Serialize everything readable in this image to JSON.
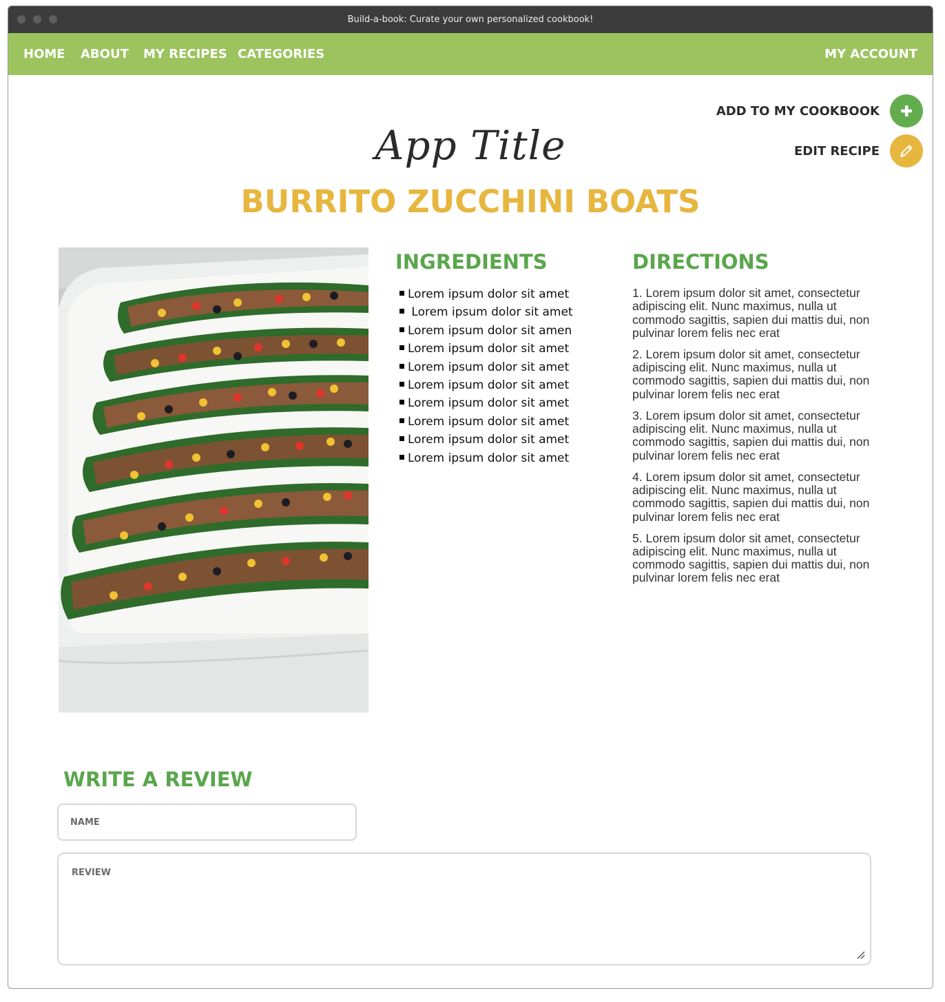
{
  "window": {
    "title": "Build-a-book: Curate your own personalized cookbook!"
  },
  "nav": {
    "home": "HOME",
    "about": "ABOUT",
    "my_recipes": "MY RECIPES",
    "categories": "CATEGORIES",
    "my_account": "MY ACCOUNT",
    "background_color": "#9cc35e"
  },
  "actions": {
    "add_label": "ADD TO MY COOKBOOK",
    "add_icon": "plus-icon",
    "add_color": "#63ad4f",
    "edit_label": "EDIT RECIPE",
    "edit_icon": "pencil-icon",
    "edit_color": "#e7b63f"
  },
  "app_title": "App Title",
  "recipe": {
    "title": "BURRITO ZUCCHINI BOATS",
    "title_color": "#e7b63f",
    "photo_alt": "burrito-zucchini-boats-photo",
    "ingredients_heading": "INGREDIENTS",
    "ingredients": [
      "Lorem ipsum dolor sit amet",
      " Lorem ipsum dolor sit amet",
      "Lorem ipsum dolor sit amen",
      "Lorem ipsum dolor sit amet",
      "Lorem ipsum dolor sit amet",
      "Lorem ipsum dolor sit amet",
      "Lorem ipsum dolor sit amet",
      "Lorem ipsum dolor sit amet",
      "Lorem ipsum dolor sit amet",
      "Lorem ipsum dolor sit amet"
    ],
    "directions_heading": "DIRECTIONS",
    "directions": [
      "1. Lorem ipsum dolor sit amet, consectetur adipiscing elit. Nunc maximus, nulla ut commodo sagittis, sapien dui mattis dui, non pulvinar lorem felis nec erat",
      "2. Lorem ipsum dolor sit amet, consectetur adipiscing elit. Nunc maximus, nulla ut commodo sagittis, sapien dui mattis dui, non pulvinar lorem felis nec erat",
      "3. Lorem ipsum dolor sit amet, consectetur adipiscing elit. Nunc maximus, nulla ut commodo sagittis, sapien dui mattis dui, non pulvinar lorem felis nec erat",
      "4. Lorem ipsum dolor sit amet, consectetur adipiscing elit. Nunc maximus, nulla ut commodo sagittis, sapien dui mattis dui, non pulvinar lorem felis nec erat",
      "5. Lorem ipsum dolor sit amet, consectetur adipiscing elit. Nunc maximus, nulla ut commodo sagittis, sapien dui mattis dui, non pulvinar lorem felis nec erat"
    ],
    "heading_color": "#5aa64c"
  },
  "review": {
    "heading": "WRITE A REVIEW",
    "name_placeholder": "NAME",
    "name_value": "",
    "review_placeholder": "REVIEW",
    "review_value": ""
  }
}
